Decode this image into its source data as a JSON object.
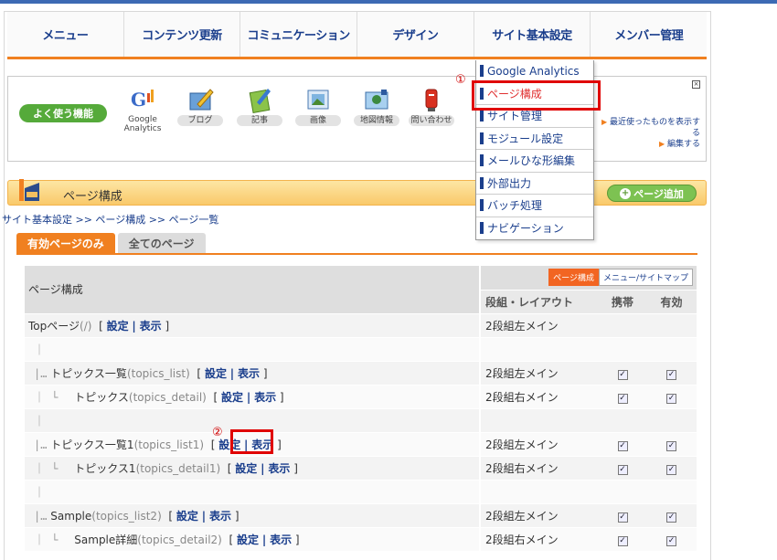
{
  "nav": {
    "items": [
      "メニュー",
      "コンテンツ更新",
      "コミュニケーション",
      "デザイン",
      "サイト基本設定",
      "メンバー管理"
    ]
  },
  "quickbar": {
    "label": "よく使う機能",
    "items": [
      {
        "caption": "Google\nAnalytics",
        "icon": "google-analytics-icon"
      },
      {
        "caption": "ブログ",
        "icon": "blog-icon"
      },
      {
        "caption": "記事",
        "icon": "article-icon"
      },
      {
        "caption": "画像",
        "icon": "image-icon"
      },
      {
        "caption": "地図情報",
        "icon": "map-icon"
      },
      {
        "caption": "問い合わせ",
        "icon": "mailbox-icon"
      }
    ],
    "recent_link": "最近使ったものを表示す\nる",
    "edit_link": "編集する"
  },
  "dropdown": {
    "items": [
      "Google Analytics",
      "ページ構成",
      "サイト管理",
      "モジュール設定",
      "メールひな形編集",
      "外部出力",
      "バッチ処理",
      "ナビゲーション"
    ],
    "active_index": 1
  },
  "markers": {
    "one": "①",
    "two": "②"
  },
  "section": {
    "title": "ページ構成",
    "add_button": "ページ追加"
  },
  "breadcrumb": "サイト基本設定 >> ページ構成 >> ページ一覧",
  "tabs": {
    "active": "有効ページのみ",
    "all": "全てのページ"
  },
  "table": {
    "header": {
      "col1": "ページ構成",
      "view_page": "ページ構成",
      "view_menu": "メニュー/サイトマップ",
      "layout": "段組・レイアウト",
      "mobile": "携帯",
      "enabled": "有効"
    },
    "rows": [
      {
        "prefix": "",
        "name": "Topページ",
        "slug": "(/)",
        "layout": "2段組左メイン",
        "mobile": false,
        "enabled": false
      },
      {
        "prefix": "｜",
        "name": "",
        "slug": "",
        "layout": "",
        "mobile": null,
        "enabled": null
      },
      {
        "prefix": "|…",
        "name": "トピックス一覧",
        "slug": "(topics_list)",
        "layout": "2段組左メイン",
        "mobile": true,
        "enabled": true
      },
      {
        "prefix": "｜ └",
        "name": "トピックス",
        "slug": "(topics_detail)",
        "layout": "2段組右メイン",
        "mobile": true,
        "enabled": true
      },
      {
        "prefix": "｜",
        "name": "",
        "slug": "",
        "layout": "",
        "mobile": null,
        "enabled": null
      },
      {
        "prefix": "|…",
        "name": "トピックス一覧1",
        "slug": "(topics_list1)",
        "layout": "2段組左メイン",
        "mobile": true,
        "enabled": true
      },
      {
        "prefix": "｜ └",
        "name": "トピックス1",
        "slug": "(topics_detail1)",
        "layout": "2段組右メイン",
        "mobile": true,
        "enabled": true
      },
      {
        "prefix": "｜",
        "name": "",
        "slug": "",
        "layout": "",
        "mobile": null,
        "enabled": null
      },
      {
        "prefix": "|…",
        "name": "Sample",
        "slug": "(topics_list2)",
        "layout": "2段組左メイン",
        "mobile": true,
        "enabled": true
      },
      {
        "prefix": "｜ └",
        "name": "Sample詳細",
        "slug": "(topics_detail2)",
        "layout": "2段組右メイン",
        "mobile": true,
        "enabled": true
      }
    ],
    "link_settings": "設定",
    "link_view": "表示",
    "link_sep": "|",
    "bracket_open": "[",
    "bracket_close": "]"
  },
  "colors": {
    "accent": "#f08020",
    "link": "#1a3e8c",
    "highlight": "#e00000",
    "nav_bar": "#3d6ab4",
    "green": "#55aa3a"
  }
}
